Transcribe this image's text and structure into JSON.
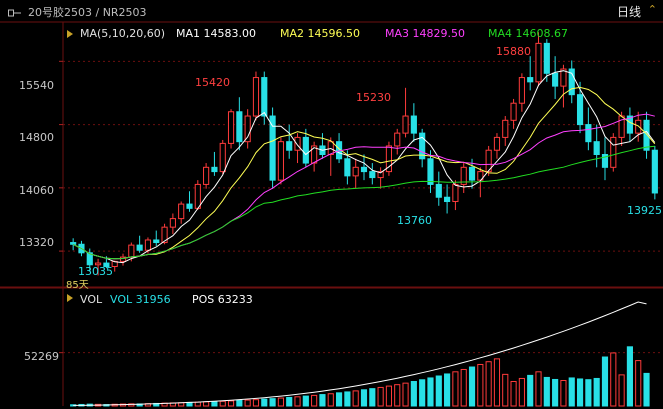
{
  "header": {
    "symbol_text": "20号胶2503 / NR2503",
    "period": "日线",
    "chevron": "⌃"
  },
  "main_legend": {
    "ma_label": "MA(5,10,20,60)",
    "ma1": "MA1 14583.00",
    "ma2": "MA2 14596.50",
    "ma3": "MA3 14829.50",
    "ma4": "MA4 14608.67"
  },
  "main_axis_ticks": [
    "15540",
    "14800",
    "14060",
    "13320"
  ],
  "annotations": {
    "high1": "15420",
    "high2": "15230",
    "high3": "15880",
    "low1": "13760",
    "low2": "13035",
    "low2_sub": "85天",
    "last_low": "13925"
  },
  "volume_legend": {
    "vol_label": "VOL",
    "vol_value": "VOL 31956",
    "pos_value": "POS 63233"
  },
  "volume_axis_ticks": [
    "52269"
  ],
  "colors": {
    "up": "#ff3b3b",
    "down": "#28e0e6",
    "ma1": "#ffffff",
    "ma2": "#ffff55",
    "ma3": "#ff40ff",
    "ma4": "#22dd22",
    "grid": "#6b0f0f",
    "axis_text": "#c8c8c8"
  },
  "chart_data": {
    "type": "candlestick",
    "y_range": [
      12900,
      16000
    ],
    "candles": [
      [
        13420,
        13470,
        13330,
        13400
      ],
      [
        13400,
        13440,
        13260,
        13300
      ],
      [
        13300,
        13350,
        13080,
        13160
      ],
      [
        13160,
        13230,
        13035,
        13180
      ],
      [
        13180,
        13260,
        13120,
        13140
      ],
      [
        13140,
        13210,
        13080,
        13200
      ],
      [
        13200,
        13290,
        13150,
        13250
      ],
      [
        13250,
        13420,
        13200,
        13390
      ],
      [
        13390,
        13500,
        13300,
        13330
      ],
      [
        13330,
        13480,
        13290,
        13450
      ],
      [
        13450,
        13560,
        13380,
        13420
      ],
      [
        13420,
        13640,
        13400,
        13600
      ],
      [
        13600,
        13760,
        13520,
        13700
      ],
      [
        13700,
        13900,
        13640,
        13870
      ],
      [
        13870,
        14020,
        13780,
        13820
      ],
      [
        13820,
        14150,
        13800,
        14100
      ],
      [
        14100,
        14350,
        14050,
        14300
      ],
      [
        14300,
        14480,
        14200,
        14250
      ],
      [
        14250,
        14620,
        14220,
        14580
      ],
      [
        14580,
        14980,
        14520,
        14950
      ],
      [
        14950,
        15120,
        14500,
        14600
      ],
      [
        14600,
        14980,
        14520,
        14900
      ],
      [
        14900,
        15420,
        14850,
        15350
      ],
      [
        15350,
        15420,
        14800,
        14900
      ],
      [
        14900,
        15000,
        14050,
        14150
      ],
      [
        14150,
        14650,
        14100,
        14600
      ],
      [
        14600,
        14800,
        14400,
        14500
      ],
      [
        14500,
        14700,
        14350,
        14650
      ],
      [
        14650,
        14750,
        14300,
        14350
      ],
      [
        14350,
        14600,
        14250,
        14550
      ],
      [
        14550,
        14700,
        14400,
        14450
      ],
      [
        14450,
        14650,
        14200,
        14600
      ],
      [
        14600,
        14700,
        14350,
        14400
      ],
      [
        14400,
        14500,
        14100,
        14200
      ],
      [
        14200,
        14400,
        14050,
        14300
      ],
      [
        14300,
        14450,
        14150,
        14250
      ],
      [
        14250,
        14350,
        14100,
        14180
      ],
      [
        14180,
        14300,
        14050,
        14250
      ],
      [
        14250,
        14600,
        14200,
        14550
      ],
      [
        14550,
        14750,
        14450,
        14700
      ],
      [
        14700,
        15230,
        14650,
        14900
      ],
      [
        14900,
        15050,
        14600,
        14700
      ],
      [
        14700,
        14750,
        14300,
        14400
      ],
      [
        14400,
        14500,
        14000,
        14100
      ],
      [
        14100,
        14250,
        13850,
        13950
      ],
      [
        13950,
        14100,
        13760,
        13900
      ],
      [
        13900,
        14150,
        13800,
        14100
      ],
      [
        14100,
        14350,
        14000,
        14300
      ],
      [
        14300,
        14400,
        14050,
        14150
      ],
      [
        14150,
        14300,
        13950,
        14250
      ],
      [
        14250,
        14550,
        14200,
        14500
      ],
      [
        14500,
        14700,
        14400,
        14650
      ],
      [
        14650,
        14900,
        14550,
        14850
      ],
      [
        14850,
        15100,
        14750,
        15050
      ],
      [
        15050,
        15400,
        14950,
        15350
      ],
      [
        15350,
        15600,
        15200,
        15300
      ],
      [
        15300,
        15880,
        15250,
        15750
      ],
      [
        15750,
        15800,
        15300,
        15400
      ],
      [
        15400,
        15600,
        15100,
        15250
      ],
      [
        15250,
        15500,
        15000,
        15450
      ],
      [
        15450,
        15550,
        15050,
        15150
      ],
      [
        15150,
        15300,
        14700,
        14800
      ],
      [
        14800,
        15000,
        14500,
        14600
      ],
      [
        14600,
        14800,
        14300,
        14450
      ],
      [
        14450,
        14650,
        14150,
        14300
      ],
      [
        14300,
        14700,
        14250,
        14650
      ],
      [
        14650,
        14950,
        14550,
        14900
      ],
      [
        14900,
        15000,
        14600,
        14700
      ],
      [
        14700,
        14950,
        14600,
        14850
      ],
      [
        14850,
        14950,
        14400,
        14500
      ],
      [
        14500,
        14550,
        13925,
        14000
      ]
    ],
    "volume_axis_max": 98000,
    "volume": [
      1200,
      1500,
      1800,
      1600,
      1400,
      1700,
      1900,
      2100,
      2000,
      2300,
      2500,
      2800,
      3000,
      3200,
      3500,
      3800,
      4100,
      4300,
      4600,
      5000,
      5400,
      5800,
      6200,
      6700,
      7200,
      7800,
      8400,
      9000,
      9700,
      10400,
      11200,
      12000,
      12900,
      13800,
      14800,
      15900,
      17000,
      18200,
      19500,
      20900,
      22400,
      24000,
      25700,
      27500,
      29400,
      31400,
      33500,
      35800,
      38200,
      40700,
      43400,
      46200,
      31000,
      24000,
      27000,
      30000,
      33500,
      28000,
      26000,
      25000,
      27500,
      26500,
      25800,
      27000,
      48000,
      52000,
      30500,
      58000,
      44500,
      31956
    ],
    "open_interest": [
      900,
      1000,
      1200,
      1400,
      1600,
      1900,
      2200,
      2500,
      2900,
      3300,
      3700,
      4100,
      4600,
      5100,
      5700,
      6300,
      7000,
      7700,
      8500,
      9300,
      10200,
      11200,
      12200,
      13300,
      14500,
      15800,
      17200,
      18700,
      20300,
      22000,
      23800,
      25700,
      27700,
      29800,
      32000,
      34300,
      36700,
      39200,
      41800,
      44500,
      47300,
      50200,
      53200,
      56300,
      59500,
      62800,
      66200,
      69700,
      73300,
      77000,
      80800,
      84700,
      88700,
      92800,
      97000,
      101300,
      105700,
      110200,
      114800,
      119500,
      124300,
      129200,
      134200,
      139300,
      144500,
      149800,
      155200,
      160700,
      166300,
      163233
    ]
  }
}
